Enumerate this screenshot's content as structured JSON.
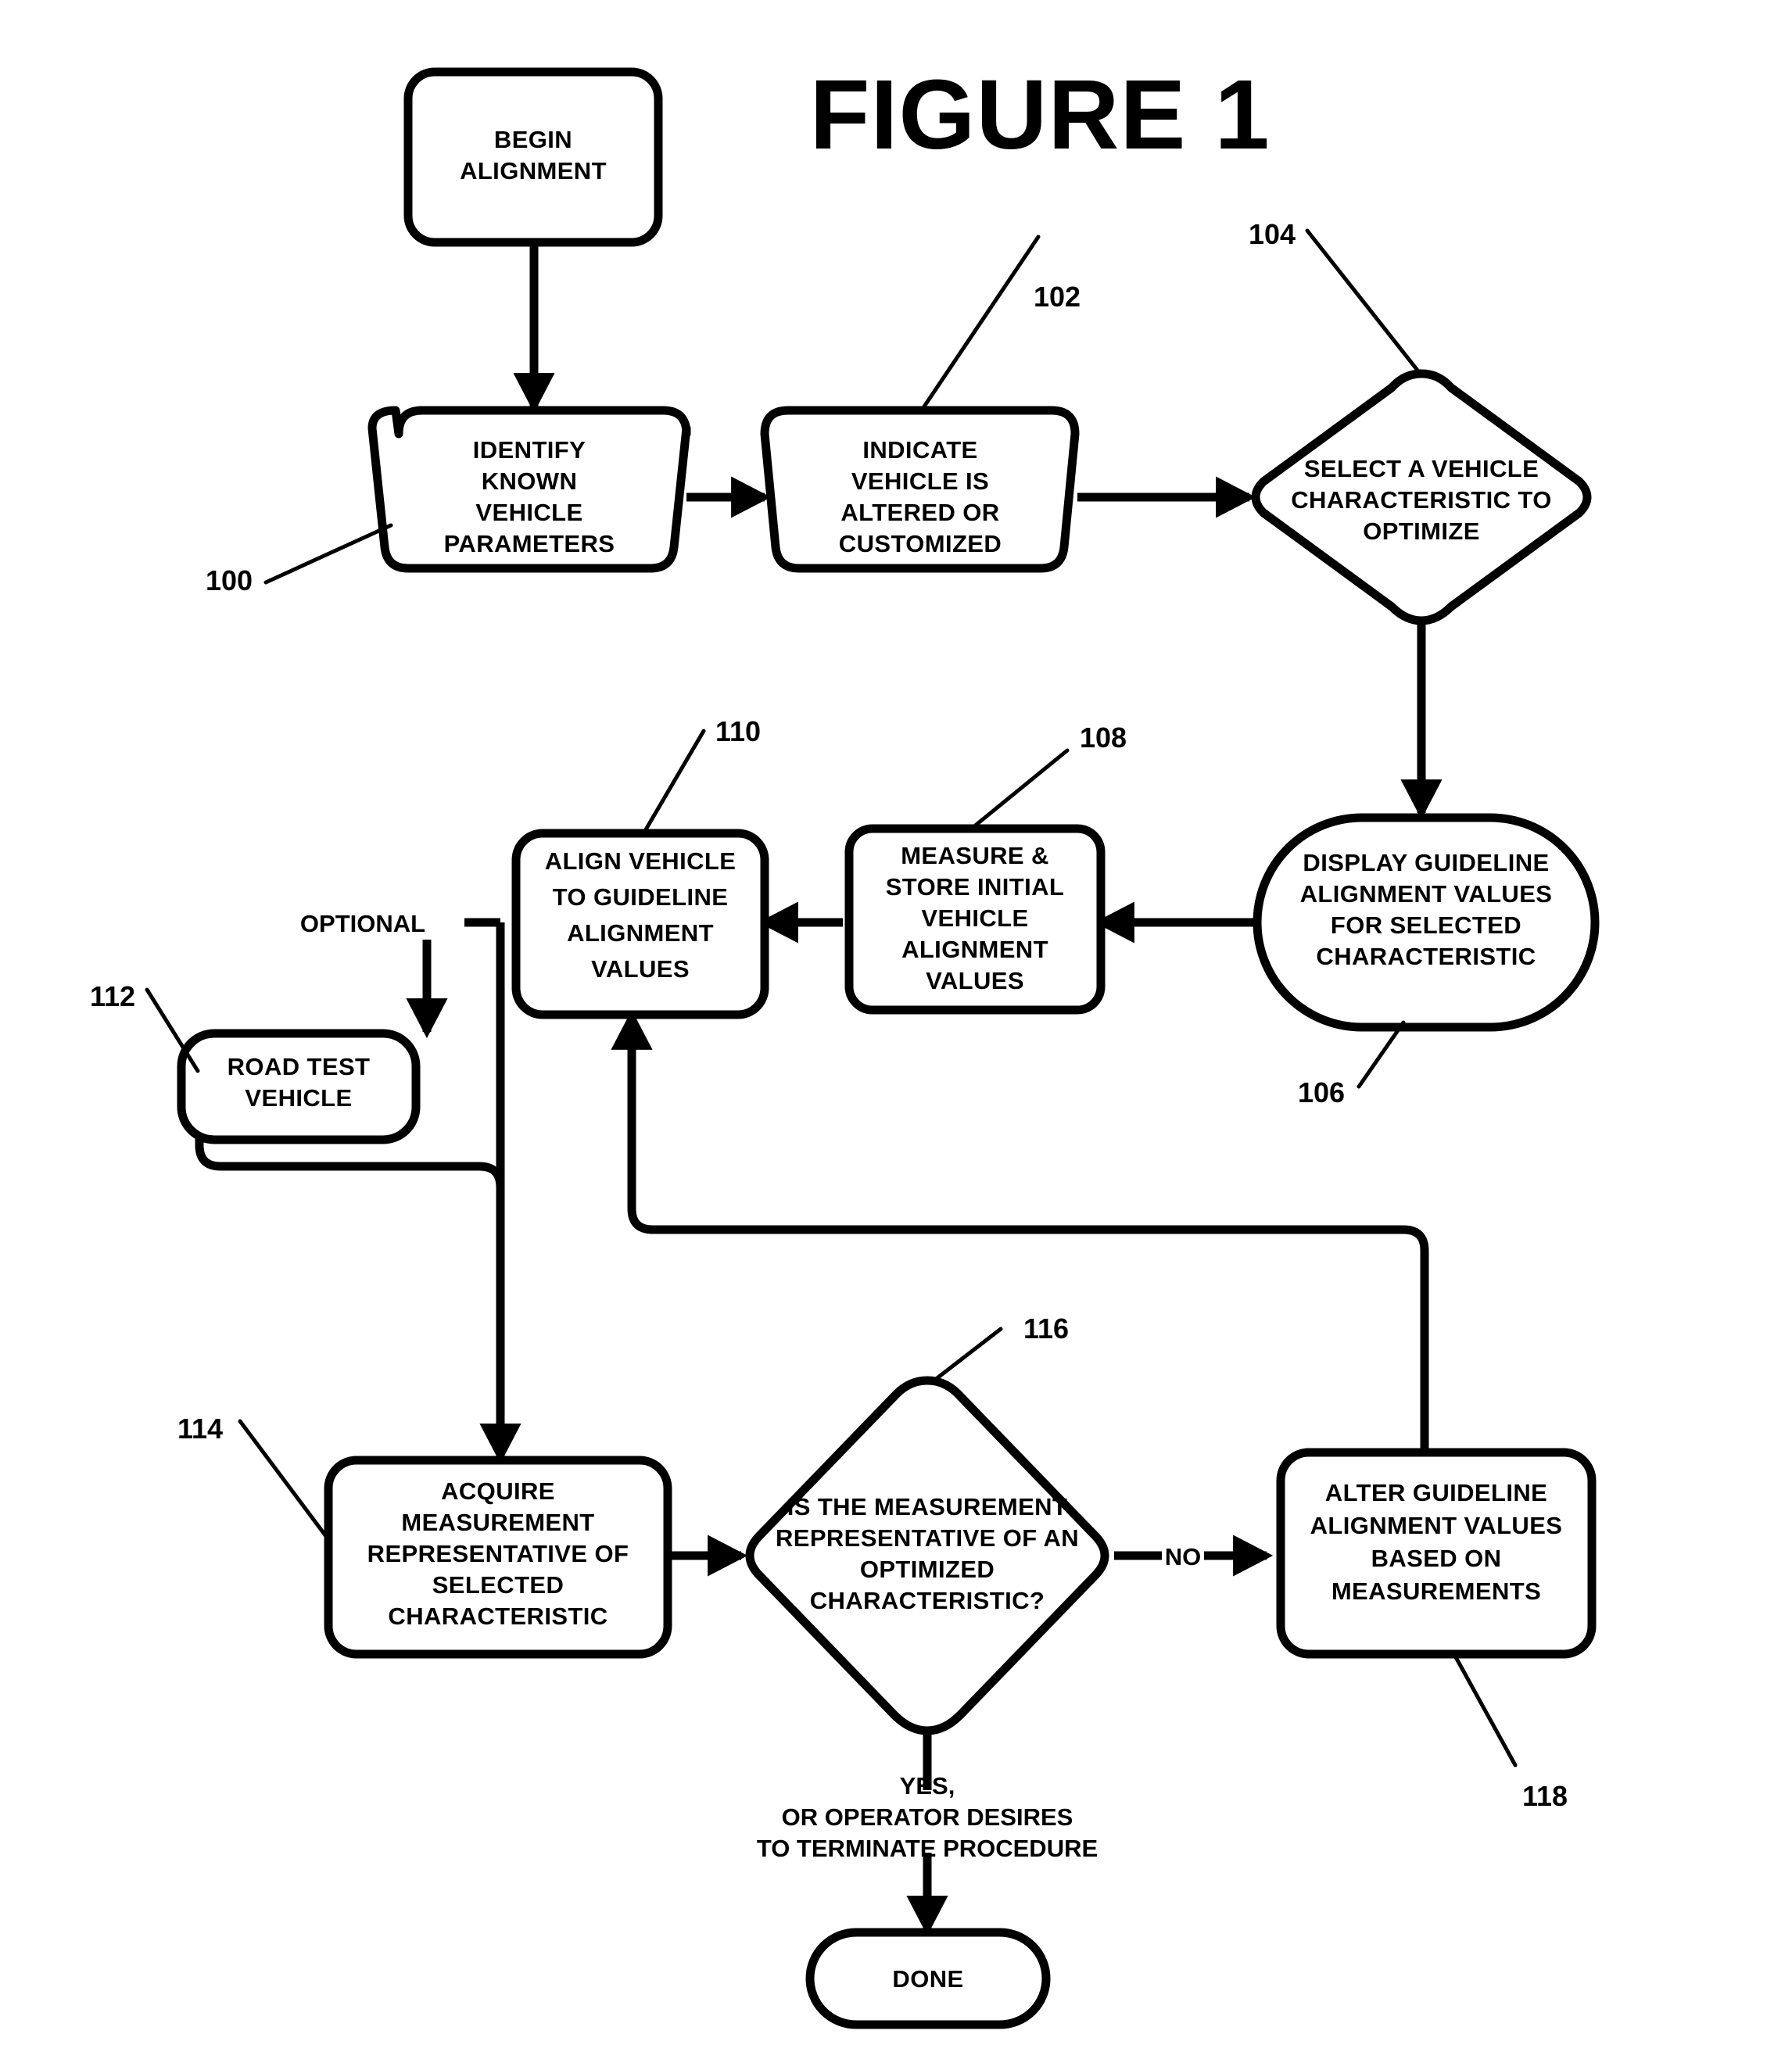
{
  "figure": {
    "title": "FIGURE 1",
    "type": "flowchart",
    "ink_color": "#000000",
    "background_color": "#ffffff"
  },
  "nodes": [
    {
      "id": "begin",
      "shape": "rounded-rectangle",
      "ref": "",
      "lines": [
        "BEGIN",
        "ALIGNMENT"
      ]
    },
    {
      "id": "identify",
      "shape": "trapezoid",
      "ref": "100",
      "lines": [
        "IDENTIFY",
        "KNOWN",
        "VEHICLE",
        "PARAMETERS"
      ]
    },
    {
      "id": "indicate",
      "shape": "trapezoid",
      "ref": "102",
      "lines": [
        "INDICATE",
        "VEHICLE IS",
        "ALTERED OR",
        "CUSTOMIZED"
      ]
    },
    {
      "id": "select",
      "shape": "diamond",
      "ref": "104",
      "lines": [
        "SELECT A VEHICLE",
        "CHARACTERISTIC TO",
        "OPTIMIZE"
      ]
    },
    {
      "id": "display",
      "shape": "stadium",
      "ref": "106",
      "lines": [
        "DISPLAY GUIDELINE",
        "ALIGNMENT VALUES",
        "FOR SELECTED",
        "CHARACTERISTIC"
      ]
    },
    {
      "id": "measure",
      "shape": "rounded-rectangle",
      "ref": "108",
      "lines": [
        "MEASURE &",
        "STORE INITIAL",
        "VEHICLE",
        "ALIGNMENT",
        "VALUES"
      ]
    },
    {
      "id": "align",
      "shape": "rounded-rectangle",
      "ref": "110",
      "lines": [
        "ALIGN VEHICLE",
        "TO GUIDELINE",
        "ALIGNMENT",
        "VALUES"
      ]
    },
    {
      "id": "roadtest",
      "shape": "rounded-rectangle",
      "ref": "112",
      "lines": [
        "ROAD TEST",
        "VEHICLE"
      ]
    },
    {
      "id": "acquire",
      "shape": "rounded-rectangle",
      "ref": "114",
      "lines": [
        "ACQUIRE",
        "MEASUREMENT",
        "REPRESENTATIVE OF",
        "SELECTED",
        "CHARACTERISTIC"
      ]
    },
    {
      "id": "decision",
      "shape": "diamond",
      "ref": "116",
      "lines": [
        "IS THE MEASUREMENT",
        "REPRESENTATIVE OF AN",
        "OPTIMIZED",
        "CHARACTERISTIC?"
      ]
    },
    {
      "id": "alter",
      "shape": "rounded-rectangle",
      "ref": "118",
      "lines": [
        "ALTER GUIDELINE",
        "ALIGNMENT VALUES",
        "BASED ON",
        "MEASUREMENTS"
      ]
    },
    {
      "id": "done",
      "shape": "stadium",
      "ref": "",
      "lines": [
        "DONE"
      ]
    }
  ],
  "edge_labels": {
    "optional": "OPTIONAL",
    "no": "NO",
    "yes_line1": "YES,",
    "yes_line2": "OR OPERATOR DESIRES",
    "yes_line3": "TO TERMINATE PROCEDURE"
  },
  "ref_numbers": {
    "n100": "100",
    "n102": "102",
    "n104": "104",
    "n106": "106",
    "n108": "108",
    "n110": "110",
    "n112": "112",
    "n114": "114",
    "n116": "116",
    "n118": "118"
  }
}
